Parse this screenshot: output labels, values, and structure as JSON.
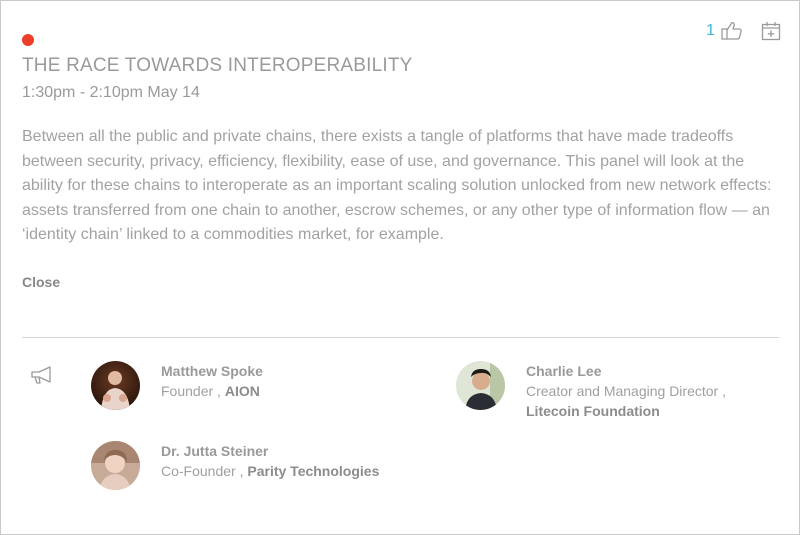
{
  "event": {
    "title": "THE RACE TOWARDS INTEROPERABILITY",
    "time": "1:30pm - 2:10pm May 14",
    "description": "Between all the public and private chains, there exists a tangle of platforms that have made tradeoffs between security, privacy, efficiency, flexibility, ease of use, and governance. This panel will look at the ability for these chains to interoperate as an important scaling solution unlocked from new network effects: assets transferred from one chain to another, escrow schemes, or any other type of information flow — an ‘identity chain’ linked to a commodities market, for example.",
    "close_label": "Close",
    "status_color": "#ec3f2b"
  },
  "actions": {
    "like_count": "1",
    "like_icon": "thumbs-up-icon",
    "calendar_icon": "add-to-calendar-icon"
  },
  "speakers_icon": "megaphone-icon",
  "speakers": [
    {
      "name": "Matthew Spoke",
      "role": "Founder",
      "separator": " , ",
      "org": "AION"
    },
    {
      "name": "Charlie Lee",
      "role": "Creator and Managing Director",
      "separator": " , ",
      "org": "Litecoin Foundation"
    },
    {
      "name": "Dr. Jutta Steiner",
      "role": "Co-Founder",
      "separator": " , ",
      "org": "Parity Technologies"
    }
  ],
  "colors": {
    "accent": "#3fb6d8",
    "text_muted": "#9a9a9a"
  }
}
